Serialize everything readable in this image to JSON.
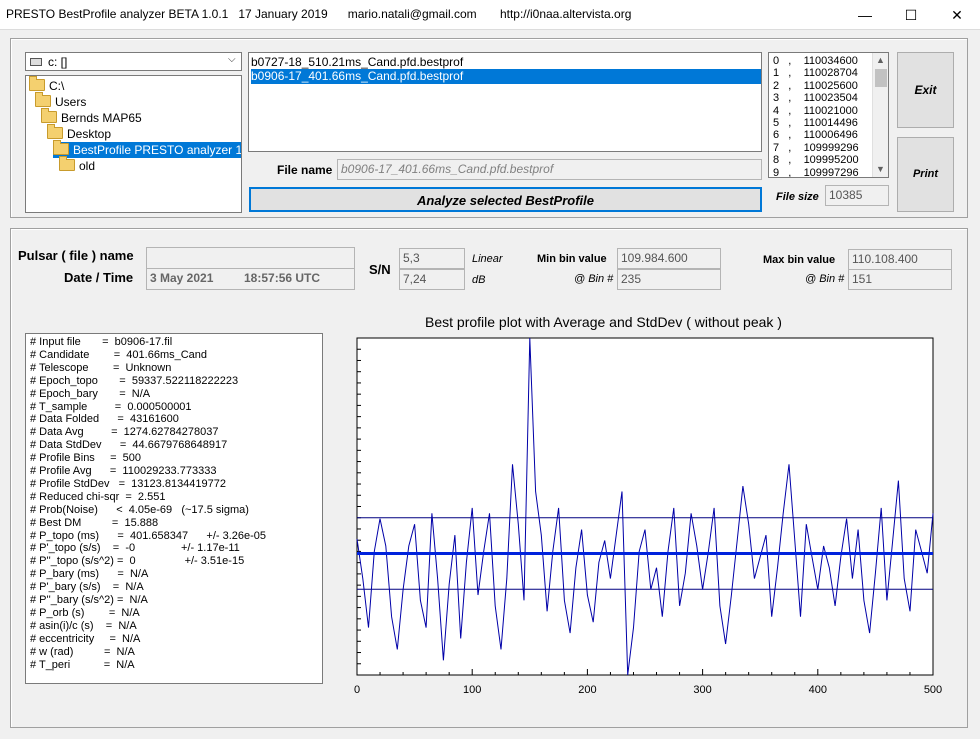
{
  "window": {
    "title": "PRESTO BestProfile analyzer BETA 1.0.1   17 January 2019      mario.natali@gmail.com       http://i0naa.altervista.org",
    "minimize_glyph": "—",
    "maximize_glyph": "☐",
    "close_glyph": "✕"
  },
  "drive": {
    "value": "c: []"
  },
  "folders": [
    {
      "label": "C:\\",
      "indent": 0
    },
    {
      "label": "Users",
      "indent": 1
    },
    {
      "label": "Bernds MAP65",
      "indent": 2
    },
    {
      "label": "Desktop",
      "indent": 3
    },
    {
      "label": "BestProfile PRESTO analyzer 1.0.1.e",
      "indent": 4,
      "selected": true
    },
    {
      "label": "old",
      "indent": 5
    }
  ],
  "files": [
    {
      "label": "b0727-18_510.21ms_Cand.pfd.bestprof",
      "selected": false
    },
    {
      "label": "b0906-17_401.66ms_Cand.pfd.bestprof",
      "selected": true
    }
  ],
  "file_name_label": "File name",
  "file_name_value": "b0906-17_401.66ms_Cand.pfd.bestprof",
  "analyze_label": "Analyze selected BestProfile",
  "bins_list": [
    "0   ,    110034600",
    "1   ,    110028704",
    "2   ,    110025600",
    "3   ,    110023504",
    "4   ,    110021000",
    "5   ,    110014496",
    "6   ,    110006496",
    "7   ,    109999296",
    "8   ,    109995200",
    "9   ,    109997296"
  ],
  "file_size_label": "File size",
  "file_size_value": "10385",
  "exit_label": "Exit",
  "print_label": "Print",
  "pulsar_label": "Pulsar ( file ) name",
  "pulsar_value": "",
  "datetime_label": "Date / Time",
  "date_value": "3 May 2021",
  "time_value": "18:57:56  UTC",
  "sn_label": "S/N",
  "sn_linear_value": "5,3",
  "sn_linear_label": "Linear",
  "sn_db_value": "7,24",
  "sn_db_label": "dB",
  "min_bin_label": "Min bin value",
  "min_bin_value": "109.984.600",
  "min_at_label": "@ Bin #",
  "min_at_value": "235",
  "max_bin_label": "Max bin value",
  "max_bin_value": "110.108.400",
  "max_at_label": "@ Bin #",
  "max_at_value": "151",
  "info_lines": [
    "# Input file       =  b0906-17.fil",
    "# Candidate        =  401.66ms_Cand",
    "# Telescope        =  Unknown",
    "# Epoch_topo       =  59337.522118222223",
    "# Epoch_bary       =  N/A",
    "# T_sample         =  0.000500001",
    "# Data Folded      =  43161600",
    "# Data Avg         =  1274.62784278037",
    "# Data StdDev      =  44.6679768648917",
    "# Profile Bins     =  500",
    "# Profile Avg      =  110029233.773333",
    "# Profile StdDev   =  13123.8134419772",
    "# Reduced chi-sqr  =  2.551",
    "# Prob(Noise)      <  4.05e-69   (~17.5 sigma)",
    "# Best DM          =  15.888",
    "# P_topo (ms)      =  401.658347      +/- 3.26e-05",
    "# P'_topo (s/s)    =  -0               +/- 1.17e-11",
    "# P''_topo (s/s^2) =  0                +/- 3.51e-15",
    "# P_bary (ms)      =  N/A",
    "# P'_bary (s/s)    =  N/A",
    "# P''_bary (s/s^2) =  N/A",
    "# P_orb (s)        =  N/A",
    "# asin(i)/c (s)    =  N/A",
    "# eccentricity     =  N/A",
    "# w (rad)          =  N/A",
    "# T_peri           =  N/A"
  ],
  "chart_data": {
    "type": "line",
    "title": "Best profile plot with  Average and StdDev ( without peak )",
    "xlim": [
      0,
      500
    ],
    "ylim": [
      109984600,
      110108400
    ],
    "x_ticks": [
      0,
      100,
      200,
      300,
      400,
      500
    ],
    "average": 110029233.773333,
    "std_upper": 110042357.586775,
    "std_lower": 110016109.959891,
    "grid": false,
    "colors": {
      "line": "#0000a8",
      "avg": "#0022dd",
      "std": "#000080"
    },
    "series": [
      {
        "x": [
          0,
          5,
          10,
          15,
          20,
          25,
          30,
          35,
          40,
          45,
          50,
          55,
          60,
          65,
          70,
          75,
          80,
          85,
          90,
          95,
          100,
          105,
          110,
          115,
          120,
          125,
          130,
          135,
          140,
          145,
          150,
          155,
          160,
          165,
          170,
          175,
          180,
          185,
          190,
          195,
          200,
          205,
          210,
          215,
          220,
          225,
          230,
          235,
          240,
          245,
          250,
          255,
          260,
          265,
          270,
          275,
          280,
          285,
          290,
          295,
          300,
          305,
          310,
          315,
          320,
          325,
          330,
          335,
          340,
          345,
          350,
          355,
          360,
          365,
          370,
          375,
          380,
          385,
          390,
          395,
          400,
          405,
          410,
          415,
          420,
          425,
          430,
          435,
          440,
          445,
          450,
          455,
          460,
          465,
          470,
          475,
          480,
          485,
          490,
          495,
          500
        ],
        "values": [
          110034600,
          110020000,
          110002000,
          110030000,
          110042000,
          110032000,
          110006000,
          109994000,
          110016000,
          110032000,
          110040000,
          110012000,
          110002000,
          110044000,
          110020000,
          109990000,
          110018000,
          110036000,
          109998000,
          110026000,
          110046000,
          110014000,
          110030000,
          110044000,
          110010000,
          109994000,
          110020000,
          110062000,
          110040000,
          110012000,
          110108400,
          110052000,
          110036000,
          110008000,
          110030000,
          110046000,
          110012000,
          110000000,
          110024000,
          110038000,
          110014000,
          110004000,
          110026000,
          110034000,
          110020000,
          110036000,
          110052000,
          109984600,
          110002000,
          110030000,
          110038000,
          110016000,
          110024000,
          110006000,
          110030000,
          110046000,
          110010000,
          110022000,
          110044000,
          110032000,
          110016000,
          110030000,
          110046000,
          110010000,
          109996000,
          110014000,
          110034000,
          110054000,
          110040000,
          110020000,
          110028000,
          110036000,
          110006000,
          110024000,
          110044000,
          110062000,
          110034000,
          110006000,
          110040000,
          110028000,
          110016000,
          110032000,
          110024000,
          110010000,
          110028000,
          110042000,
          110020000,
          110038000,
          110012000,
          110000000,
          110022000,
          110046000,
          110012000,
          110034000,
          110056000,
          110020000,
          110008000,
          110038000,
          110030000,
          110022000,
          110044000
        ]
      }
    ]
  }
}
